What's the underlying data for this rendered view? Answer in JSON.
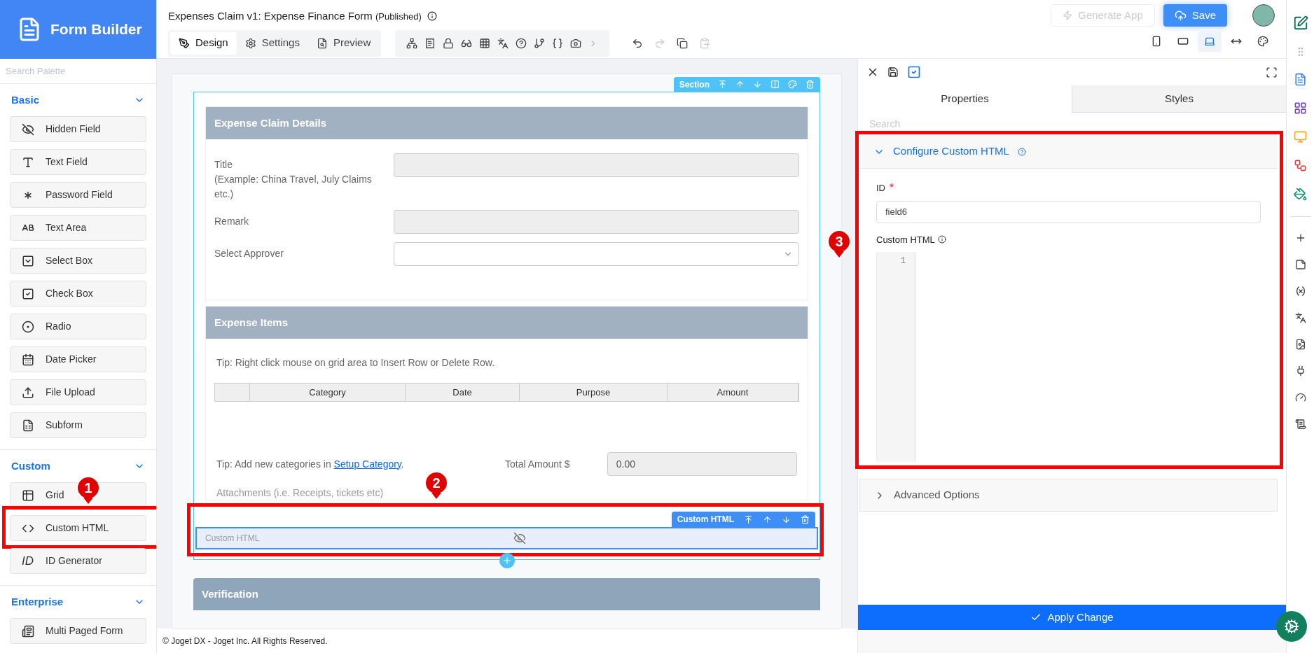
{
  "app": {
    "title": "Form Builder"
  },
  "form": {
    "title": "Expenses Claim v1: Expense Finance Form",
    "status": "(Published)"
  },
  "mode_tabs": [
    {
      "label": "Design",
      "kind": "design",
      "selected": true
    },
    {
      "label": "Settings",
      "kind": "settings",
      "selected": false
    },
    {
      "label": "Preview",
      "kind": "preview",
      "selected": false
    }
  ],
  "header_actions": {
    "generate": {
      "label": "Generate App",
      "disabled": true
    },
    "save": {
      "label": "Save"
    }
  },
  "device_views": [
    {
      "kind": "phone",
      "selected": false
    },
    {
      "kind": "tablet",
      "selected": false
    },
    {
      "kind": "laptop",
      "selected": true
    },
    {
      "kind": "width",
      "selected": false
    },
    {
      "kind": "theme",
      "selected": false
    }
  ],
  "palette": {
    "search_placeholder": "Search Palette",
    "groups": [
      {
        "name": "Basic",
        "expanded": true,
        "items": [
          {
            "label": "Hidden Field",
            "kind": "hidden"
          },
          {
            "label": "Text Field",
            "kind": "text"
          },
          {
            "label": "Password Field",
            "kind": "password"
          },
          {
            "label": "Text Area",
            "kind": "textarea"
          },
          {
            "label": "Select Box",
            "kind": "select"
          },
          {
            "label": "Check Box",
            "kind": "checkbox"
          },
          {
            "label": "Radio",
            "kind": "radio"
          },
          {
            "label": "Date Picker",
            "kind": "date"
          },
          {
            "label": "File Upload",
            "kind": "upload"
          },
          {
            "label": "Subform",
            "kind": "subform"
          }
        ]
      },
      {
        "name": "Custom",
        "expanded": true,
        "items": [
          {
            "label": "Grid",
            "kind": "grid"
          },
          {
            "label": "Custom HTML",
            "kind": "html"
          },
          {
            "label": "ID Generator",
            "kind": "id",
            "icon_text": "ID"
          }
        ]
      },
      {
        "name": "Enterprise",
        "expanded": true,
        "items": [
          {
            "label": "Multi Paged Form",
            "kind": "multipage"
          }
        ]
      }
    ]
  },
  "canvas": {
    "section_tag": "Section",
    "details": {
      "heading": "Expense Claim Details",
      "fields": [
        {
          "label": "Title\n(Example: China Travel, July Claims etc.)",
          "kind": "text"
        },
        {
          "label": "Remark",
          "kind": "text"
        },
        {
          "label": "Select Approver",
          "kind": "select"
        }
      ]
    },
    "items": {
      "heading": "Expense Items",
      "tip": "Tip: Right click mouse on grid area to Insert Row or Delete Row.",
      "columns": [
        "Category",
        "Date",
        "Purpose",
        "Amount"
      ],
      "category_tip": "Tip: Add new categories in ",
      "category_link": "Setup Category",
      "category_tip_end": ".",
      "total_label": "Total Amount $",
      "total_value": "0.00",
      "attachments": "Attachments (i.e. Receipts, tickets etc)"
    },
    "custom_html": {
      "tag": "Custom HTML",
      "label": "Custom HTML",
      "hidden": true
    },
    "verification": "Verification"
  },
  "properties": {
    "tabs": [
      {
        "label": "Properties",
        "selected": true
      },
      {
        "label": "Styles",
        "selected": false
      }
    ],
    "search_placeholder": "Search",
    "section": {
      "title": "Configure Custom HTML",
      "expanded": true
    },
    "id_label": "ID",
    "id_required": true,
    "id_value": "field6",
    "html_label": "Custom HTML",
    "line_number": "1",
    "advanced": {
      "title": "Advanced Options",
      "expanded": false
    },
    "apply": "Apply Change"
  },
  "footer": "© Joget DX - Joget Inc. All Rights Reserved.",
  "callouts": [
    {
      "number": "1"
    },
    {
      "number": "2"
    },
    {
      "number": "3"
    }
  ]
}
